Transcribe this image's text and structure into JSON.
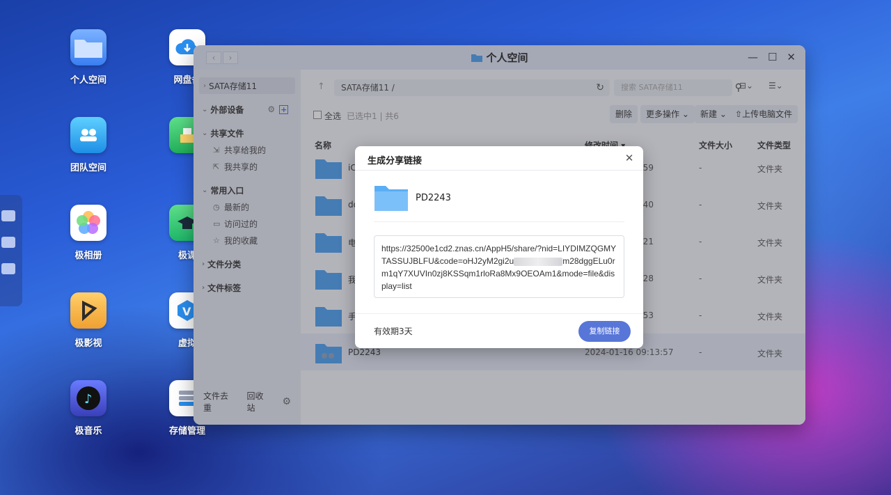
{
  "desktop": {
    "icons": [
      {
        "label": "个人空间"
      },
      {
        "label": "团队空间"
      },
      {
        "label": "极相册"
      },
      {
        "label": "极影视"
      },
      {
        "label": "极音乐"
      },
      {
        "label": "网盘备"
      },
      {
        "label": "极课"
      },
      {
        "label": "虚拟"
      },
      {
        "label": "存储管理"
      }
    ]
  },
  "window": {
    "title": "个人空间",
    "sidebar": {
      "storage": "SATA存储11",
      "external": "外部设备",
      "shared_group": "共享文件",
      "shared_to_me": "共享给我的",
      "my_shared": "我共享的",
      "common_group": "常用入口",
      "recent": "最新的",
      "visited": "访问过的",
      "favorites": "我的收藏",
      "category": "文件分类",
      "tags": "文件标签",
      "dedupe": "文件去重",
      "recycle": "回收站"
    },
    "path": "SATA存储11 /",
    "search_placeholder": "搜索 SATA存储11",
    "select_all": "全选",
    "selection_status": "已选中1 | 共6",
    "buttons": {
      "delete": "删除",
      "more": "更多操作",
      "new": "新建",
      "upload": "上传电脑文件"
    },
    "columns": {
      "name": "名称",
      "modified": "修改时间",
      "size": "文件大小",
      "type": "文件类型"
    },
    "rows": [
      {
        "name": "iC",
        "modified": "0:59",
        "size": "-",
        "type": "文件夹"
      },
      {
        "name": "do",
        "modified": "8:40",
        "size": "-",
        "type": "文件夹"
      },
      {
        "name": "电",
        "modified": "8:21",
        "size": "-",
        "type": "文件夹"
      },
      {
        "name": "我",
        "modified": "4:28",
        "size": "-",
        "type": "文件夹"
      },
      {
        "name": "手",
        "modified": "9:53",
        "size": "-",
        "type": "文件夹"
      },
      {
        "name": "PD2243",
        "modified": "2024-01-16 09:13:57",
        "size": "-",
        "type": "文件夹"
      }
    ]
  },
  "modal": {
    "title": "生成分享链接",
    "file_name": "PD2243",
    "link_part1": "https://32500e1cd2.znas.cn/AppH5/share/?nid=LIYDIMZQGMYTASSUJBLFU&code=oHJ2yM2gi2u",
    "link_part2": "m28dggELu0rm1qY7XUVIn0zj8KSSqm1rloRa8Mx9OEOAm1&mode=file&display=list",
    "validity": "有效期3天",
    "copy_button": "复制链接"
  },
  "colors": {
    "accent": "#5876d8",
    "folder": "#4a9ff0"
  }
}
